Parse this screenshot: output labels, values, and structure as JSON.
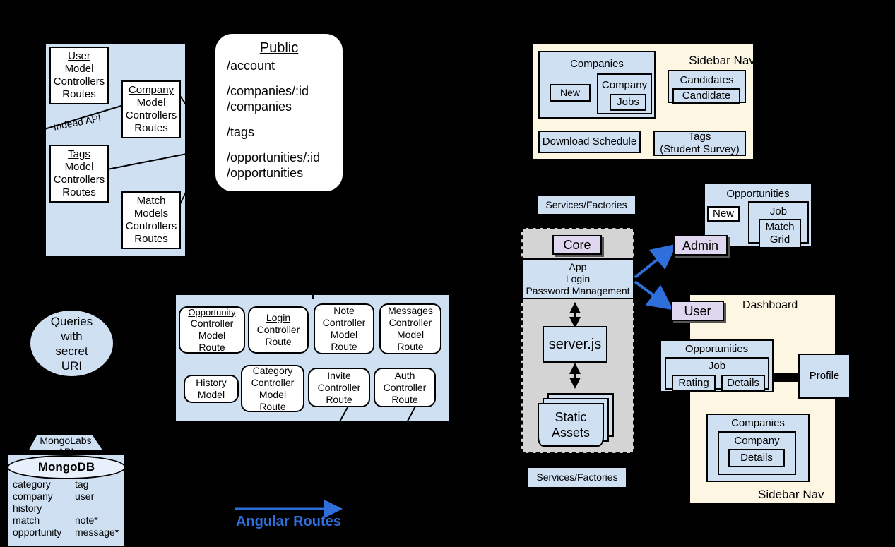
{
  "colors": {
    "blue": "#cfe0f3",
    "cream": "#fdf6e3",
    "lavender": "#ded7ef",
    "gray": "#d4d4d4",
    "accent": "#2f6fdb",
    "white": "#ffffff"
  },
  "api_panel": {
    "label_indeed_api": "Indeed API",
    "boxes": [
      {
        "title": "User",
        "lines": [
          "Model",
          "Controllers",
          "Routes"
        ]
      },
      {
        "title": "Company",
        "lines": [
          "Model",
          "Controllers",
          "Routes"
        ]
      },
      {
        "title": "Tags",
        "lines": [
          "Model",
          "Controllers",
          "Routes"
        ]
      },
      {
        "title": "Match",
        "lines": [
          "Models",
          "Controllers",
          "Routes"
        ]
      }
    ]
  },
  "public_card": {
    "title": "Public",
    "groups": [
      [
        "/account"
      ],
      [
        "/companies/:id",
        "/companies"
      ],
      [
        "/tags"
      ],
      [
        "/opportunities/:id",
        "/opportunities"
      ]
    ]
  },
  "sidebar_nav_top": {
    "label": "Sidebar Nav",
    "companies": {
      "title": "Companies",
      "new": "New",
      "company": "Company",
      "jobs": "Jobs"
    },
    "candidates": {
      "title": "Candidates",
      "candidate": "Candidate"
    },
    "download_schedule": "Download Schedule",
    "tags": {
      "line1": "Tags",
      "line2": "(Student Survey)"
    }
  },
  "queries_bubble": {
    "lines": [
      "Queries",
      "with",
      "secret",
      "URI"
    ]
  },
  "mongo": {
    "api_label_line1": "MongoLabs",
    "api_label_line2": "API",
    "db_title": "MongoDB",
    "collections_left": [
      "category",
      "company",
      "history",
      "match",
      "opportunity"
    ],
    "collections_right": [
      "tag",
      "user",
      "",
      "note*",
      "message*"
    ]
  },
  "angular_panel": {
    "arrow_label": "Angular Routes",
    "row1": [
      {
        "title": "Opportunity",
        "lines": [
          "Controller",
          "Model",
          "Route"
        ]
      },
      {
        "title": "Login",
        "lines": [
          "Controller",
          "Route"
        ]
      },
      {
        "title": "Note",
        "lines": [
          "Controller",
          "Model",
          "Route"
        ]
      },
      {
        "title": "Messages",
        "lines": [
          "Controller",
          "Model",
          "Route"
        ]
      }
    ],
    "row2": [
      {
        "title": "History",
        "lines": [
          "Model"
        ]
      },
      {
        "title": "Category",
        "lines": [
          "Controller",
          "Model",
          "Route"
        ]
      },
      {
        "title": "Invite",
        "lines": [
          "Controller",
          "Route"
        ]
      },
      {
        "title": "Auth",
        "lines": [
          "Controller",
          "Route"
        ]
      }
    ]
  },
  "core_column": {
    "services_top": "Services/Factories",
    "services_bottom": "Services/Factories",
    "core": "Core",
    "app_lines": [
      "App",
      "Login",
      "Password Management"
    ],
    "server": "server.js",
    "static_assets_line1": "Static",
    "static_assets_line2": "Assets"
  },
  "roles": {
    "admin": "Admin",
    "user": "User"
  },
  "admin_area": {
    "opportunities": {
      "title": "Opportunities",
      "new": "New",
      "job": "Job",
      "match": "Match",
      "grid": "Grid"
    }
  },
  "dashboard": {
    "label": "Dashboard",
    "sidebar_nav_label": "Sidebar Nav",
    "opportunities": {
      "title": "Opportunities",
      "job": "Job",
      "rating": "Rating",
      "details": "Details"
    },
    "profile": "Profile",
    "companies": {
      "title": "Companies",
      "company": "Company",
      "details": "Details"
    }
  }
}
